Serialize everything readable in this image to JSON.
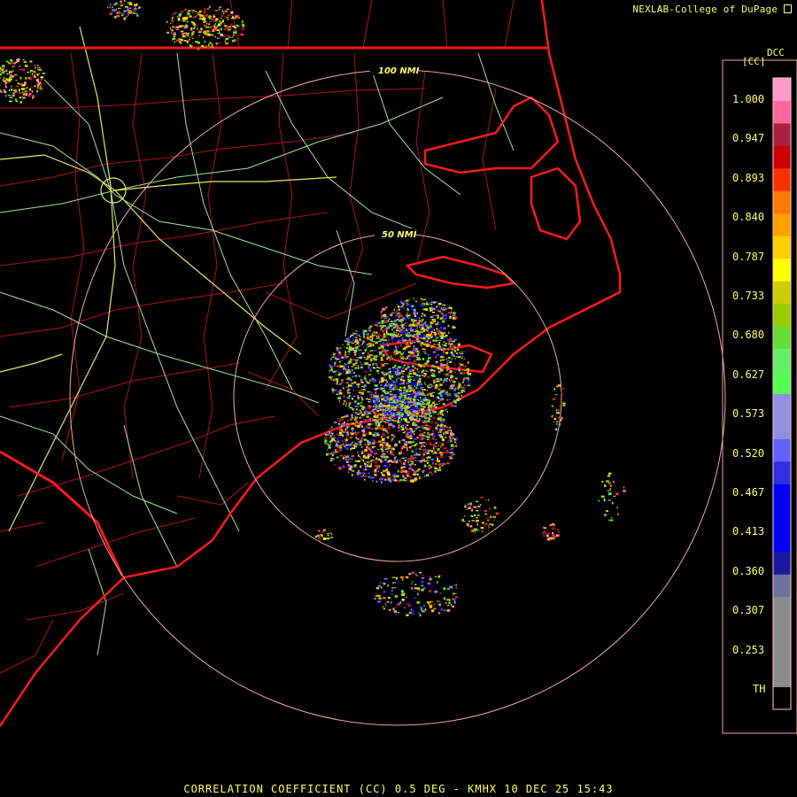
{
  "header": {
    "credit": "NEXLAB-College of DuPage",
    "product_code": "DCC",
    "unit_label": "[CC]"
  },
  "rings": [
    {
      "label": "100 NMI"
    },
    {
      "label": "50 NMI"
    }
  ],
  "legend": {
    "ticks": [
      "1.000",
      "0.947",
      "0.893",
      "0.840",
      "0.787",
      "0.733",
      "0.680",
      "0.627",
      "0.573",
      "0.520",
      "0.467",
      "0.413",
      "0.360",
      "0.307",
      "0.253",
      "TH"
    ],
    "colors": [
      "#000000",
      "#8c8c8c",
      "#8c8c8c",
      "#8c8c8c",
      "#8c8c8c",
      "#7070a0",
      "#1a1aa0",
      "#0000ff",
      "#0000ff",
      "#0000ff",
      "#3030e0",
      "#6060ff",
      "#9090e0",
      "#9090e0",
      "#55ff55",
      "#66ee66",
      "#66dd33",
      "#99cc00",
      "#cccc00",
      "#ffff00",
      "#ffd000",
      "#ffa000",
      "#ff7a00",
      "#ff3000",
      "#cc0000",
      "#aa2040",
      "#ff6699",
      "#ff99cc"
    ]
  },
  "footer": {
    "text": "CORRELATION COEFFICIENT (CC) 0.5 DEG - KMHX 10 DEC 25 15:43"
  },
  "map_colors": {
    "county": "#b01020",
    "state": "#ff1a1a",
    "highway": "#a0e6a0",
    "interstate": "#e8e860",
    "ring": "#f0a8a8"
  }
}
